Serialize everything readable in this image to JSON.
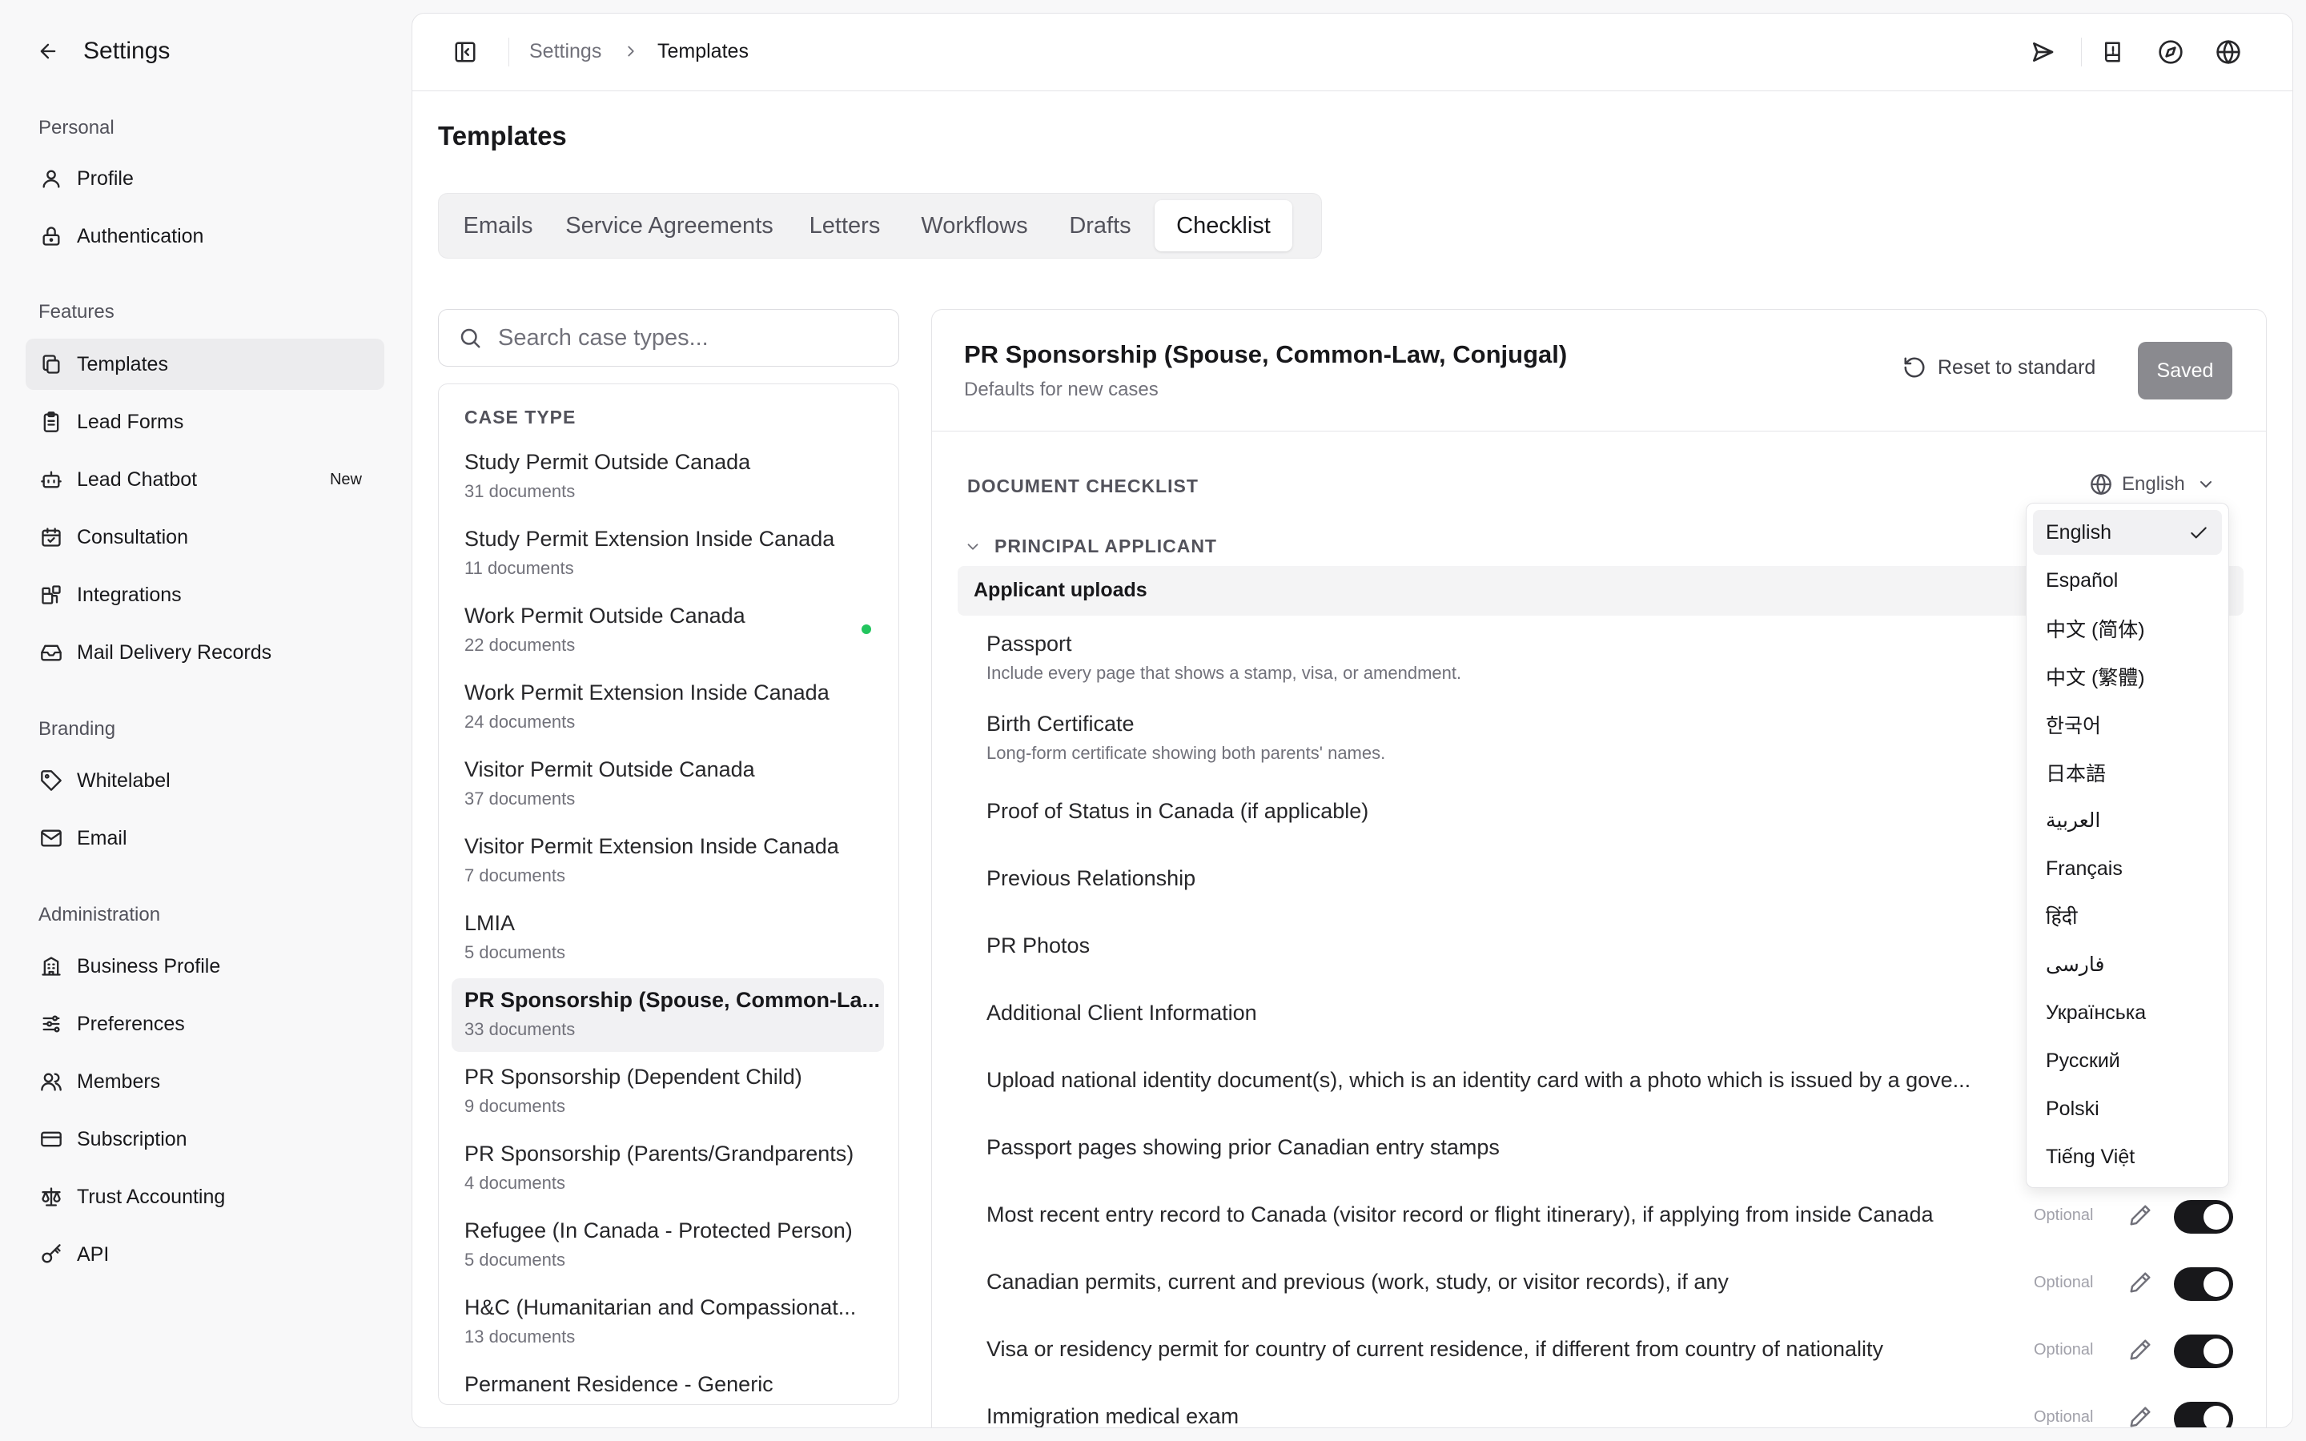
{
  "sidebar": {
    "title": "Settings",
    "sections": {
      "personal": "Personal",
      "features": "Features",
      "branding": "Branding",
      "administration": "Administration"
    },
    "items": {
      "profile": "Profile",
      "authentication": "Authentication",
      "templates": "Templates",
      "lead_forms": "Lead Forms",
      "lead_chatbot": "Lead Chatbot",
      "lead_chatbot_badge": "New",
      "consultation": "Consultation",
      "integrations": "Integrations",
      "mail_delivery": "Mail Delivery Records",
      "whitelabel": "Whitelabel",
      "email": "Email",
      "business_profile": "Business Profile",
      "preferences": "Preferences",
      "members": "Members",
      "subscription": "Subscription",
      "trust_accounting": "Trust Accounting",
      "api": "API"
    },
    "active_item": "templates"
  },
  "breadcrumb": {
    "parent": "Settings",
    "current": "Templates"
  },
  "page_title": "Templates",
  "tabs": [
    "Emails",
    "Service Agreements",
    "Letters",
    "Workflows",
    "Drafts",
    "Checklist"
  ],
  "active_tab": "Checklist",
  "search": {
    "placeholder": "Search case types...",
    "value": ""
  },
  "case_types": {
    "header": "CASE TYPE",
    "items": [
      {
        "name": "Study Permit Outside Canada",
        "docs": "31 documents"
      },
      {
        "name": "Study Permit Extension Inside Canada",
        "docs": "11 documents"
      },
      {
        "name": "Work Permit Outside Canada",
        "docs": "22 documents",
        "indicator": true
      },
      {
        "name": "Work Permit Extension Inside Canada",
        "docs": "24 documents"
      },
      {
        "name": "Visitor Permit Outside Canada",
        "docs": "37 documents"
      },
      {
        "name": "Visitor Permit Extension Inside Canada",
        "docs": "7 documents"
      },
      {
        "name": "LMIA",
        "docs": "5 documents"
      },
      {
        "name": "PR Sponsorship (Spouse, Common-La...",
        "docs": "33 documents",
        "active": true
      },
      {
        "name": "PR Sponsorship (Dependent Child)",
        "docs": "9 documents"
      },
      {
        "name": "PR Sponsorship (Parents/Grandparents)",
        "docs": "4 documents"
      },
      {
        "name": "Refugee (In Canada - Protected Person)",
        "docs": "5 documents"
      },
      {
        "name": "H&C (Humanitarian and Compassionat...",
        "docs": "13 documents"
      },
      {
        "name": "Permanent Residence - Generic",
        "docs": ""
      }
    ]
  },
  "detail": {
    "title": "PR Sponsorship (Spouse, Common-Law, Conjugal)",
    "subtitle": "Defaults for new cases",
    "reset_label": "Reset to standard",
    "saved_label": "Saved",
    "checklist_label": "DOCUMENT CHECKLIST",
    "language": "English",
    "group_label": "PRINCIPAL APPLICANT",
    "uploads_label": "Applicant uploads",
    "optional_label": "Optional",
    "documents": [
      {
        "name": "Passport",
        "desc": "Include every page that shows a stamp, visa, or amendment."
      },
      {
        "name": "Birth Certificate",
        "desc": "Long-form certificate showing both parents' names."
      },
      {
        "name": "Proof of Status in Canada (if applicable)",
        "desc": ""
      },
      {
        "name": "Previous Relationship",
        "desc": ""
      },
      {
        "name": "PR Photos",
        "desc": ""
      },
      {
        "name": "Additional Client Information",
        "desc": ""
      },
      {
        "name": "Upload national identity document(s), which is an identity card with a photo which is issued by a gove...",
        "desc": ""
      },
      {
        "name": "Passport pages showing prior Canadian entry stamps",
        "desc": ""
      },
      {
        "name": "Most recent entry record to Canada (visitor record or flight itinerary), if applying from inside Canada",
        "desc": "",
        "enabled": true
      },
      {
        "name": "Canadian permits, current and previous (work, study, or visitor records), if any",
        "desc": "",
        "enabled": true
      },
      {
        "name": "Visa or residency permit for country of current residence, if different from country of nationality",
        "desc": "",
        "enabled": true
      },
      {
        "name": "Immigration medical exam",
        "desc": "",
        "enabled": true
      }
    ]
  },
  "language_menu": {
    "selected": "English",
    "options": [
      "English",
      "Español",
      "中文 (简体)",
      "中文 (繁體)",
      "한국어",
      "日本語",
      "العربية",
      "Français",
      "हिंदी",
      "فارسی",
      "Українська",
      "Русский",
      "Polski",
      "Tiếng Việt"
    ]
  },
  "colors": {
    "accent": "#18181b",
    "active_bg": "#ececee",
    "status_dot": "#22c55e",
    "saved_button": "#8a8a8f"
  }
}
